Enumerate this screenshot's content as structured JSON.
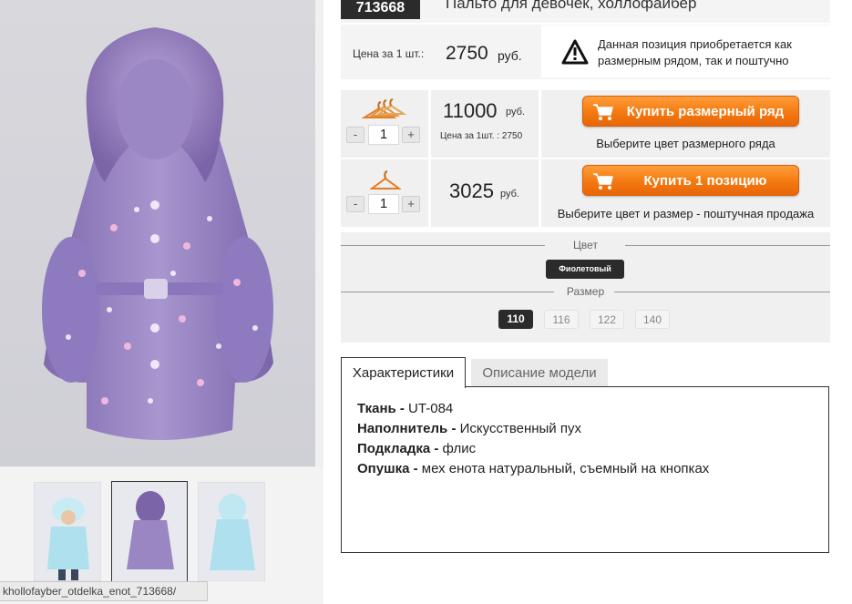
{
  "product": {
    "article": "713668",
    "title": "Пальто для девочек, холлофайбер",
    "price_label": "Цена за 1 шт.:",
    "price_value": "2750",
    "price_currency": "руб.",
    "notice": "Данная позиция приобретается как размерным рядом, так и поштучно"
  },
  "row_set": {
    "quantity": "1",
    "minus": "-",
    "plus": "+",
    "sum": "11000",
    "currency": "руб.",
    "unit_note": "Цена за 1шт. : 2750",
    "button_label": "Купить размерный ряд",
    "hint": "Выберите цвет размерного ряда"
  },
  "row_single": {
    "quantity": "1",
    "minus": "-",
    "plus": "+",
    "sum": "3025",
    "currency": "руб.",
    "button_label": "Купить 1 позицию",
    "hint": "Выберите цвет и размер - поштучная продажа"
  },
  "options": {
    "color_label": "Цвет",
    "color_selected": "Фиолетовый",
    "size_label": "Размер",
    "sizes": [
      "110",
      "116",
      "122",
      "140"
    ]
  },
  "tabs": {
    "specs": "Характеристики",
    "description": "Описание модели"
  },
  "specs": [
    {
      "name": "Ткань -",
      "value": " UT-084"
    },
    {
      "name": "Наполнитель -",
      "value": " Искусственный пух"
    },
    {
      "name": "Подкладка -",
      "value": " флис"
    },
    {
      "name": "Опушка -",
      "value": " мех енота натуральный, съемный на кнопках"
    }
  ],
  "status_url": "khollofayber_otdelka_enot_713668/",
  "colors": {
    "accent_orange": "#f4790f",
    "dark": "#2b2b2b",
    "coat_purple": "#9b86c4",
    "coat_blue": "#aee0ee"
  },
  "icons": {
    "notice": "warning-icon",
    "cart": "cart-icon",
    "set": "hangers-icon",
    "single": "hanger-icon"
  }
}
